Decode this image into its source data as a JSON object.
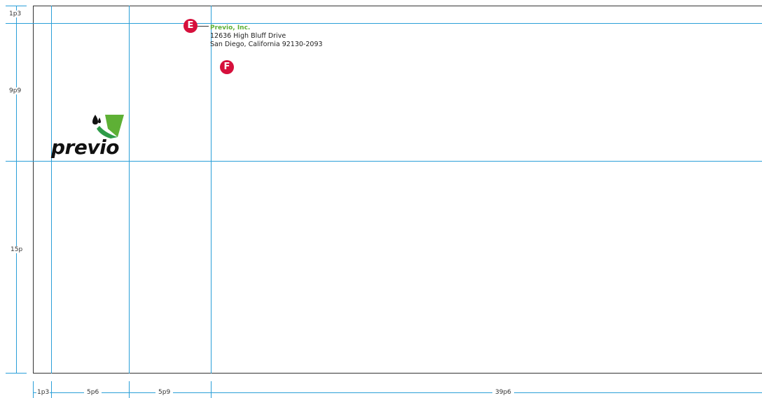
{
  "address": {
    "company": "Previo, Inc.",
    "street": "12636 High Bluff Drive",
    "city_line": "San Diego, California 92130-2093"
  },
  "logo": {
    "wordmark": "previo"
  },
  "markers": {
    "e": "E",
    "f": "F"
  },
  "dimensions": {
    "vertical": [
      "1p3",
      "9p9",
      "15p"
    ],
    "horizontal": [
      "1p3",
      "5p6",
      "5p9",
      "39p6"
    ]
  },
  "colors": {
    "guide": "#2a9fd8",
    "marker": "#d6103c",
    "company": "#5eb035",
    "logo_green_light": "#5eb035",
    "logo_green_dark": "#2e9b48"
  }
}
